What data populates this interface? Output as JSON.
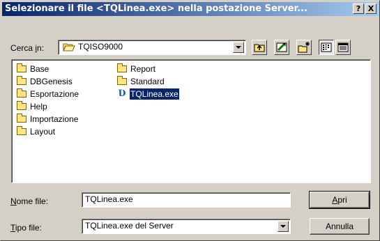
{
  "title": "Selezionare il file <TQLinea.exe> nella postazione Server...",
  "title_buttons": {
    "help": "?",
    "close": "X"
  },
  "look_in": {
    "label_pre": "Cerca ",
    "label_u": "i",
    "label_post": "n:",
    "value": "TQISO9000"
  },
  "toolbar": {
    "icons": [
      "up-folder-icon",
      "desktop-icon",
      "new-folder-icon",
      "list-view-icon",
      "details-view-icon"
    ]
  },
  "files": {
    "col1": [
      {
        "name": "Base",
        "type": "folder"
      },
      {
        "name": "DBGenesis",
        "type": "folder"
      },
      {
        "name": "Esportazione",
        "type": "folder"
      },
      {
        "name": "Help",
        "type": "folder"
      },
      {
        "name": "Importazione",
        "type": "folder"
      },
      {
        "name": "Layout",
        "type": "folder"
      }
    ],
    "col2": [
      {
        "name": "Report",
        "type": "folder"
      },
      {
        "name": "Standard",
        "type": "folder"
      },
      {
        "name": "TQLinea.exe",
        "type": "exe",
        "selected": true
      }
    ]
  },
  "filename": {
    "label_u": "N",
    "label_post": "ome file:",
    "value": "TQLinea.exe"
  },
  "filetype": {
    "label_u": "T",
    "label_post": "ipo file:",
    "value": "TQLinea.exe del Server"
  },
  "buttons": {
    "open_u": "A",
    "open_post": "pri",
    "cancel": "Annulla"
  },
  "colors": {
    "title_start": "#0a246a",
    "title_end": "#a6caf0",
    "face": "#d4d0c8",
    "selection": "#0a246a"
  }
}
